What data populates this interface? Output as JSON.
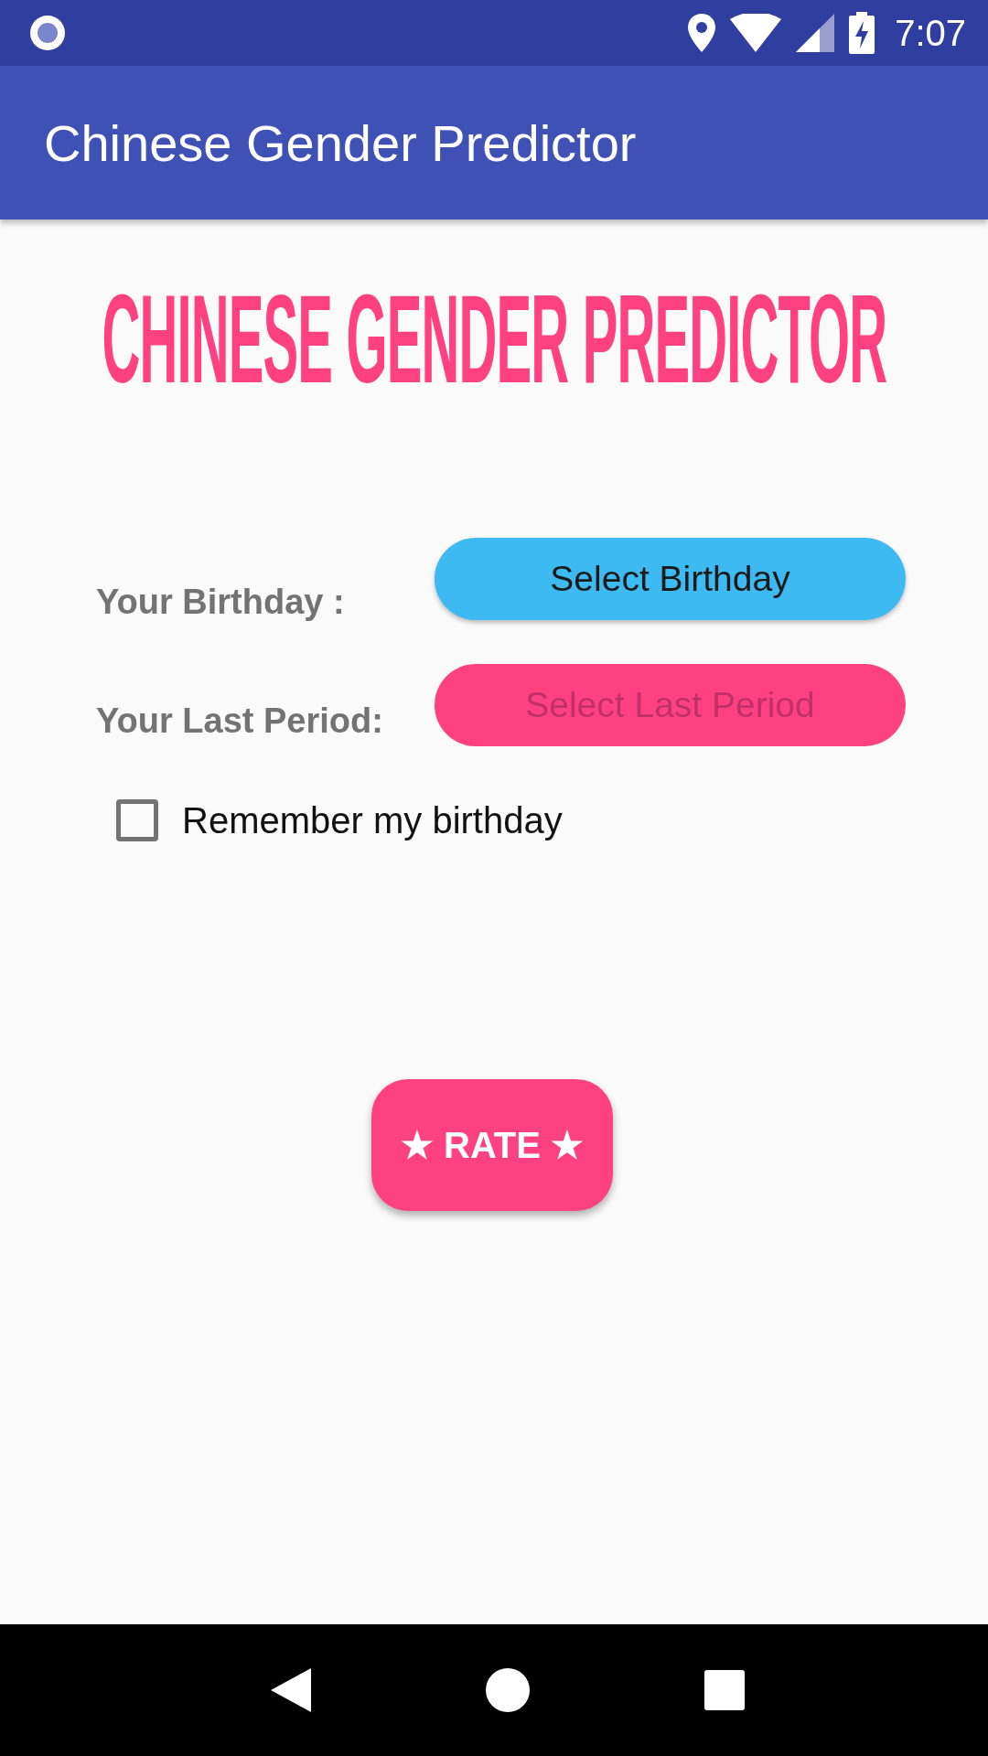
{
  "status_bar": {
    "time": "7:07"
  },
  "app_bar": {
    "title": "Chinese Gender Predictor"
  },
  "heading": "CHINESE GENDER PREDICTOR",
  "fields": [
    {
      "label": "Your Birthday :",
      "button": "Select Birthday",
      "disabled": false,
      "color": "#3dbaf2"
    },
    {
      "label": "Your Last Period:",
      "button": "Select Last Period",
      "disabled": true,
      "color": "#ff4081"
    }
  ],
  "remember": {
    "label": "Remember my birthday",
    "checked": false
  },
  "rate_button": "★ RATE ★"
}
